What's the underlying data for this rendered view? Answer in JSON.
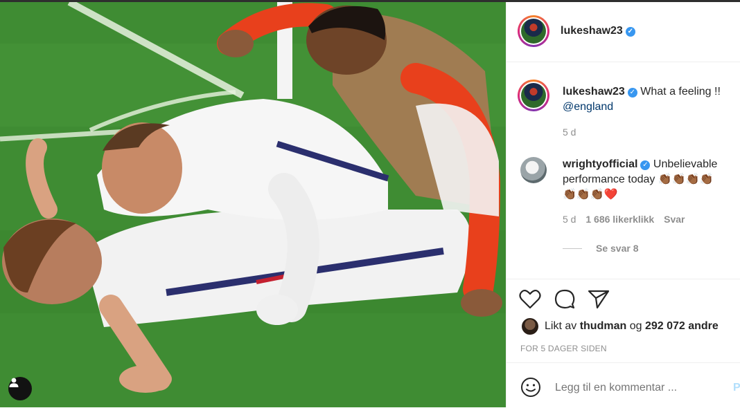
{
  "post": {
    "username": "lukeshaw23",
    "caption_text": "What a feeling !!",
    "caption_mention": "@england",
    "caption_age": "5 d"
  },
  "comments": [
    {
      "username": "wrightyofficial",
      "text_line1": "Unbelievable",
      "text_line2": "performance today 👏🏾👏🏾👏🏾👏🏾",
      "text_line3": "👏🏾👏🏾👏🏾❤️",
      "age": "5 d",
      "likes": "1 686 likerklikk",
      "reply_label": "Svar",
      "view_replies": "Se svar 8"
    }
  ],
  "likes": {
    "prefix": "Likt av",
    "liker": "thudman",
    "joiner": "og",
    "others": "292 072 andre"
  },
  "timestamp": "FOR 5 DAGER SIDEN",
  "comment_input": {
    "placeholder": "Legg til en kommentar ...",
    "post_label": "P"
  },
  "icons": {
    "like": "heart-icon",
    "comment": "comment-bubble-icon",
    "share": "paper-plane-icon",
    "emoji": "smiley-icon",
    "user_tag": "person-icon",
    "verified": "verified-badge-icon"
  },
  "colors": {
    "verified": "#3897f0",
    "link": "#00376b",
    "muted": "#8e8e8e",
    "pitch": "#3f8f34"
  }
}
